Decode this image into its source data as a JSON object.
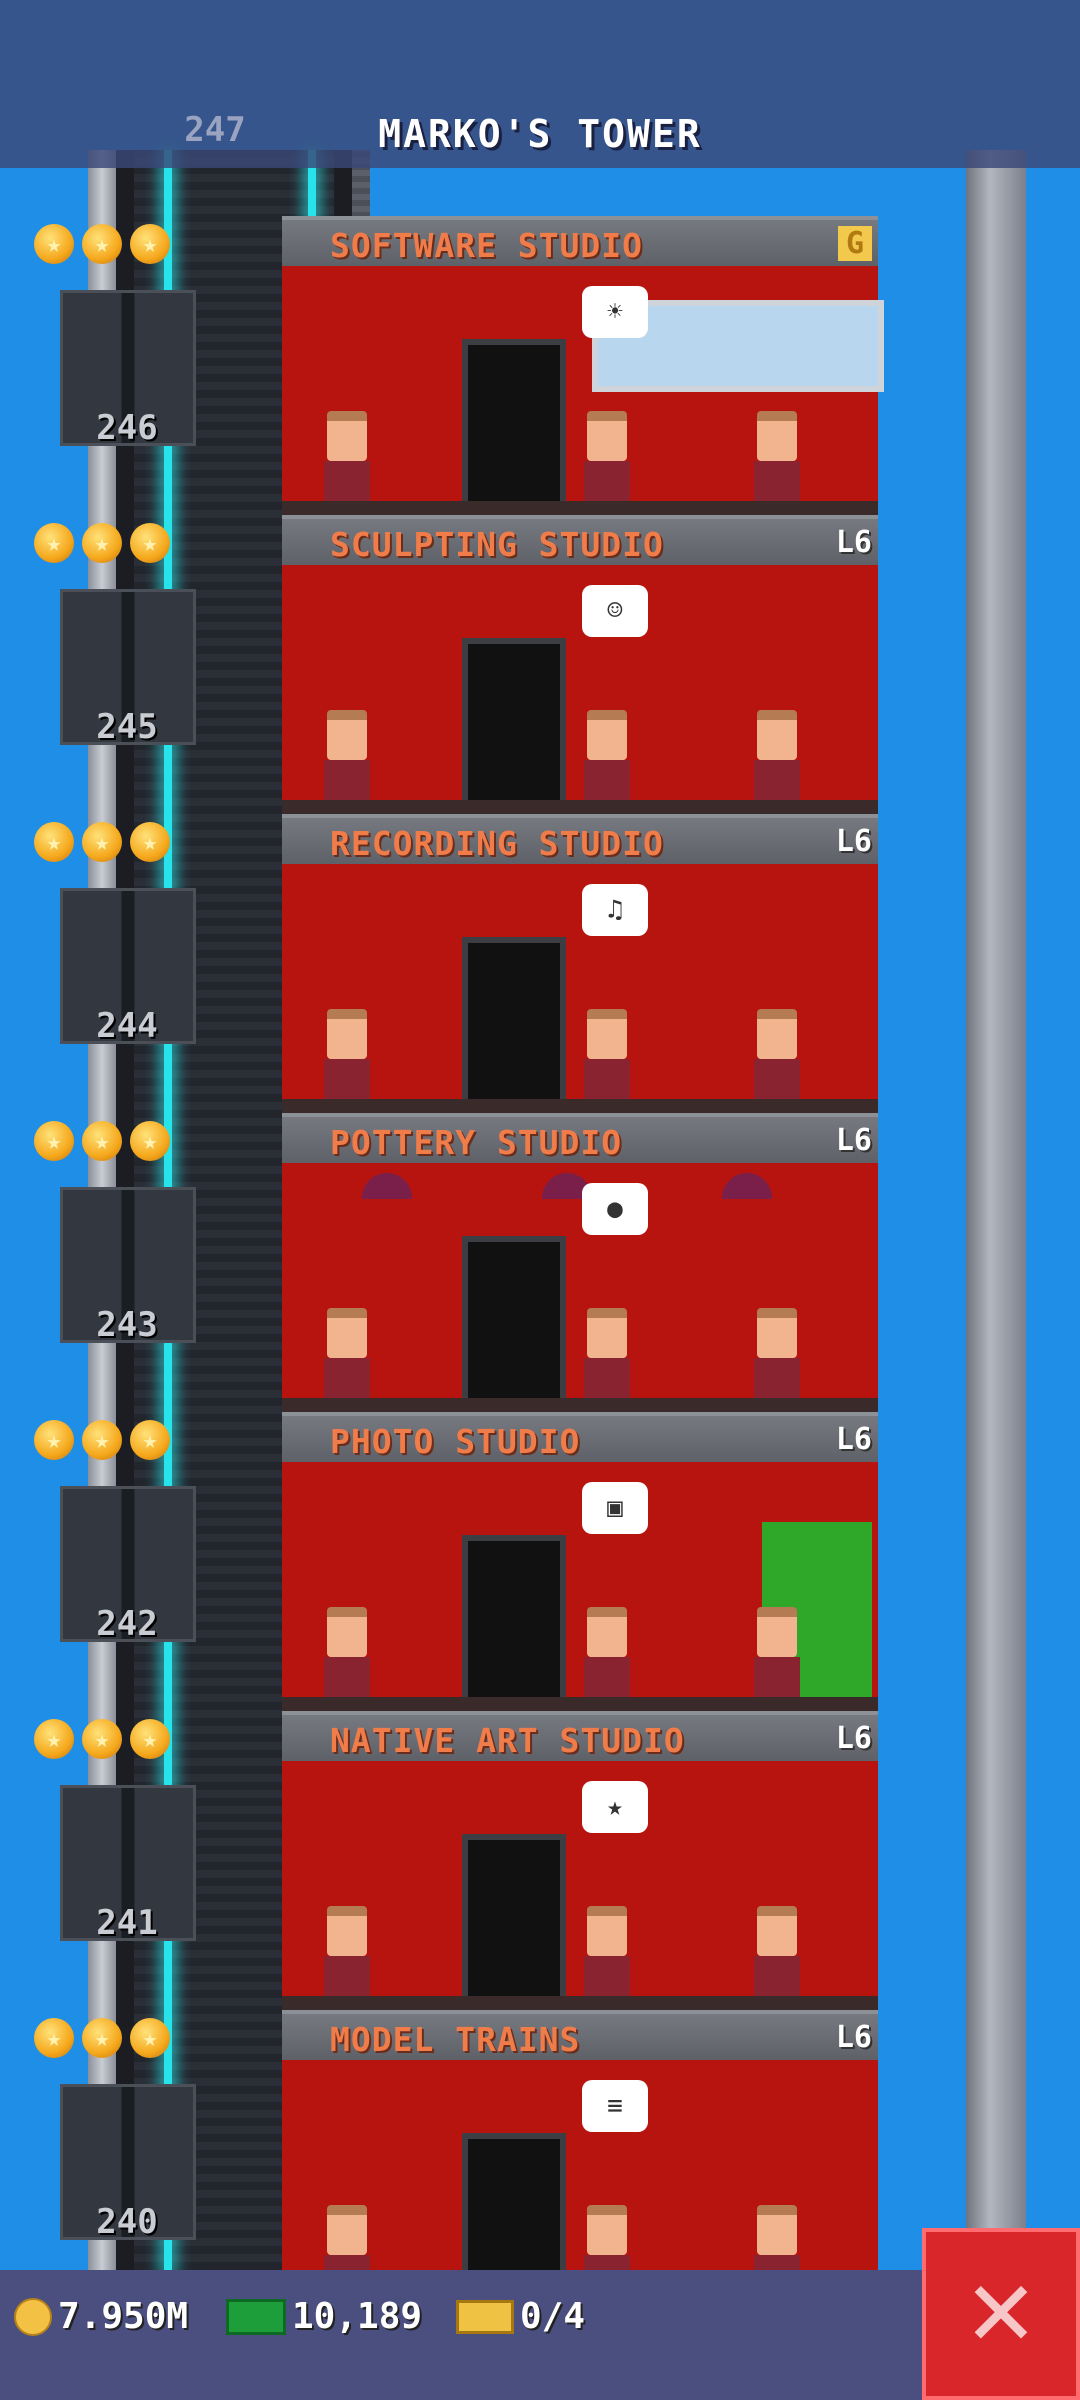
{
  "header": {
    "title": "MARKO'S TOWER",
    "top_floor_number": "247"
  },
  "floors": [
    {
      "name": "SOFTWARE STUDIO",
      "level": "G",
      "number": "246",
      "stars": 3,
      "bubble": "☀"
    },
    {
      "name": "SCULPTING STUDIO",
      "level": "L6",
      "number": "245",
      "stars": 3,
      "bubble": "☺"
    },
    {
      "name": "RECORDING STUDIO",
      "level": "L6",
      "number": "244",
      "stars": 3,
      "bubble": "♫"
    },
    {
      "name": "POTTERY STUDIO",
      "level": "L6",
      "number": "243",
      "stars": 3,
      "bubble": "●"
    },
    {
      "name": "PHOTO STUDIO",
      "level": "L6",
      "number": "242",
      "stars": 3,
      "bubble": "▣"
    },
    {
      "name": "NATIVE ART STUDIO",
      "level": "L6",
      "number": "241",
      "stars": 3,
      "bubble": "★"
    },
    {
      "name": "MODEL TRAINS",
      "level": "L6",
      "number": "240",
      "stars": 3,
      "bubble": "≡"
    }
  ],
  "status": {
    "coins": "7.950M",
    "bux": "10,189",
    "tickets": "0/4"
  },
  "colors": {
    "sky": "#1f8ee6",
    "room_wall": "#b8140f",
    "floor_name": "#f07c4a",
    "elevator_cable": "#29e3ea",
    "close_button": "#d9262b"
  },
  "icons": {
    "coin": "coin-icon",
    "bux": "bux-icon",
    "ticket": "ticket-icon",
    "close": "close-icon",
    "star": "star-icon"
  }
}
